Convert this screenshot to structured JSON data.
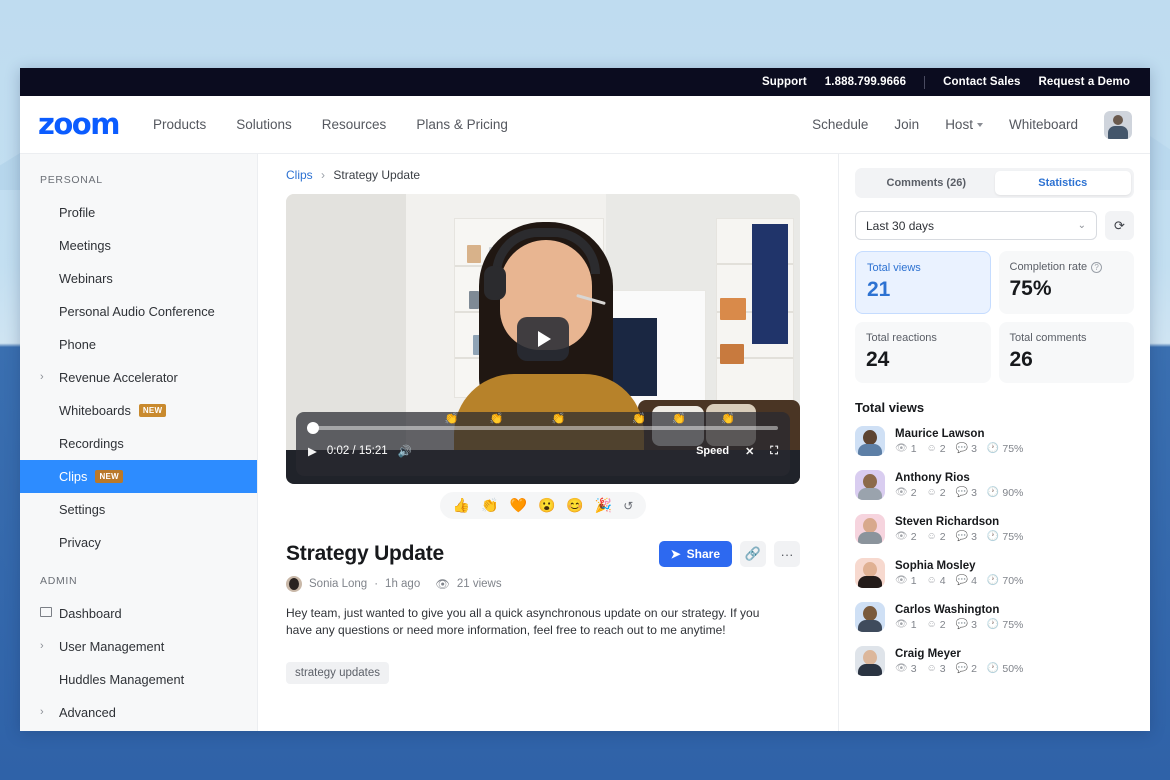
{
  "utility_bar": {
    "links": [
      "Support",
      "1.888.799.9666",
      "Contact Sales",
      "Request a Demo"
    ]
  },
  "topnav": {
    "logo": "zoom",
    "links": [
      "Products",
      "Solutions",
      "Resources",
      "Plans & Pricing"
    ],
    "right_links": [
      "Schedule",
      "Join",
      "Host",
      "Whiteboard"
    ],
    "avatar": "user-avatar"
  },
  "sidebar": {
    "sections": [
      {
        "heading": "PERSONAL",
        "items": [
          {
            "label": "Profile",
            "expandable": false,
            "active": false
          },
          {
            "label": "Meetings",
            "expandable": false,
            "active": false
          },
          {
            "label": "Webinars",
            "expandable": false,
            "active": false
          },
          {
            "label": "Personal Audio  Conference",
            "expandable": false,
            "active": false
          },
          {
            "label": "Phone",
            "expandable": false,
            "active": false
          },
          {
            "label": "Revenue Accelerator",
            "expandable": true,
            "active": false
          },
          {
            "label": "Whiteboards",
            "expandable": false,
            "active": false,
            "badge": "NEW"
          },
          {
            "label": "Recordings",
            "expandable": false,
            "active": false
          },
          {
            "label": "Clips",
            "expandable": false,
            "active": true,
            "badge": "NEW"
          },
          {
            "label": "Settings",
            "expandable": false,
            "active": false
          },
          {
            "label": "Privacy",
            "expandable": false,
            "active": false
          }
        ]
      },
      {
        "heading": "ADMIN",
        "items": [
          {
            "label": "Dashboard",
            "expandable": false,
            "active": false,
            "external": true
          },
          {
            "label": "User Management",
            "expandable": true,
            "active": false
          },
          {
            "label": "Huddles Management",
            "expandable": false,
            "active": false
          },
          {
            "label": "Advanced",
            "expandable": true,
            "active": false
          }
        ]
      }
    ]
  },
  "breadcrumb": {
    "parent": "Clips",
    "separator": "›",
    "current": "Strategy Update"
  },
  "player": {
    "current_time": "0:02",
    "duration": "15:21",
    "time_display": "0:02 / 15:21",
    "speed_label": "Speed",
    "progress_percent": 2,
    "timeline_markers": [
      "👏",
      "👏",
      "👏",
      "👏",
      "👏",
      "👏"
    ],
    "play_icon": "play-icon",
    "volume_icon": "volume-icon",
    "closed_caption_icon": "cc-icon",
    "fullscreen_icon": "fullscreen-icon"
  },
  "reaction_bar": {
    "emojis": [
      "👍",
      "👏",
      "🧡",
      "😮",
      "😊",
      "🎉"
    ],
    "add_reaction_icon": "add-reaction-icon"
  },
  "clip": {
    "title": "Strategy Update",
    "author": "Sonia Long",
    "time_ago": "1h ago",
    "views_label": "21 views",
    "description": "Hey team, just wanted to give you all a quick asynchronous update on our strategy. If you have any questions or need more information, feel free to reach out to me anytime!",
    "tag": "strategy updates",
    "share_label": "Share",
    "link_icon": "link-icon",
    "more_icon": "more-options-icon"
  },
  "panel": {
    "tabs": [
      {
        "label": "Comments (26)",
        "active": false
      },
      {
        "label": "Statistics",
        "active": true
      }
    ],
    "date_filter": "Last 30 days",
    "refresh_icon": "refresh-icon",
    "stats": [
      {
        "label": "Total views",
        "value": "21",
        "selected": true,
        "help": false
      },
      {
        "label": "Completion rate",
        "value": "75%",
        "selected": false,
        "help": true
      },
      {
        "label": "Total reactions",
        "value": "24",
        "selected": false,
        "help": false
      },
      {
        "label": "Total comments",
        "value": "26",
        "selected": false,
        "help": false
      }
    ],
    "viewers_heading": "Total views",
    "viewers": [
      {
        "name": "Maurice Lawson",
        "views": "1",
        "reactions": "2",
        "comments": "3",
        "completion": "75%",
        "avatar_bg": "#cfe0f5",
        "skin": "#5d4432",
        "shirt": "#5d7fa6"
      },
      {
        "name": "Anthony Rios",
        "views": "2",
        "reactions": "2",
        "comments": "3",
        "completion": "90%",
        "avatar_bg": "#d9cdf0",
        "skin": "#8c6a4a",
        "shirt": "#9aa3ad"
      },
      {
        "name": "Steven Richardson",
        "views": "2",
        "reactions": "2",
        "comments": "3",
        "completion": "75%",
        "avatar_bg": "#f6d4de",
        "skin": "#d8a98c",
        "shirt": "#8b949c"
      },
      {
        "name": "Sophia Mosley",
        "views": "1",
        "reactions": "4",
        "comments": "4",
        "completion": "70%",
        "avatar_bg": "#f7d9cf",
        "skin": "#e0b193",
        "shirt": "#241c1a"
      },
      {
        "name": "Carlos Washington",
        "views": "1",
        "reactions": "2",
        "comments": "3",
        "completion": "75%",
        "avatar_bg": "#cfe0f5",
        "skin": "#7a5a3c",
        "shirt": "#3f4b5c"
      },
      {
        "name": "Craig Meyer",
        "views": "3",
        "reactions": "3",
        "comments": "2",
        "completion": "50%",
        "avatar_bg": "#dfe4ea",
        "skin": "#dcb79b",
        "shirt": "#2b3442"
      }
    ],
    "stat_icons": {
      "views": "eye-icon",
      "reactions": "emoji-icon",
      "comments": "comment-icon",
      "completion": "clock-icon"
    }
  },
  "colors": {
    "brand_blue": "#0b5cff",
    "accent_blue": "#2d8cff",
    "share_blue": "#2d69f0",
    "badge_orange": "#c98a2e",
    "utility_bar_bg": "#0b0c1f",
    "page_bg_bottom": "#2f62a8"
  }
}
